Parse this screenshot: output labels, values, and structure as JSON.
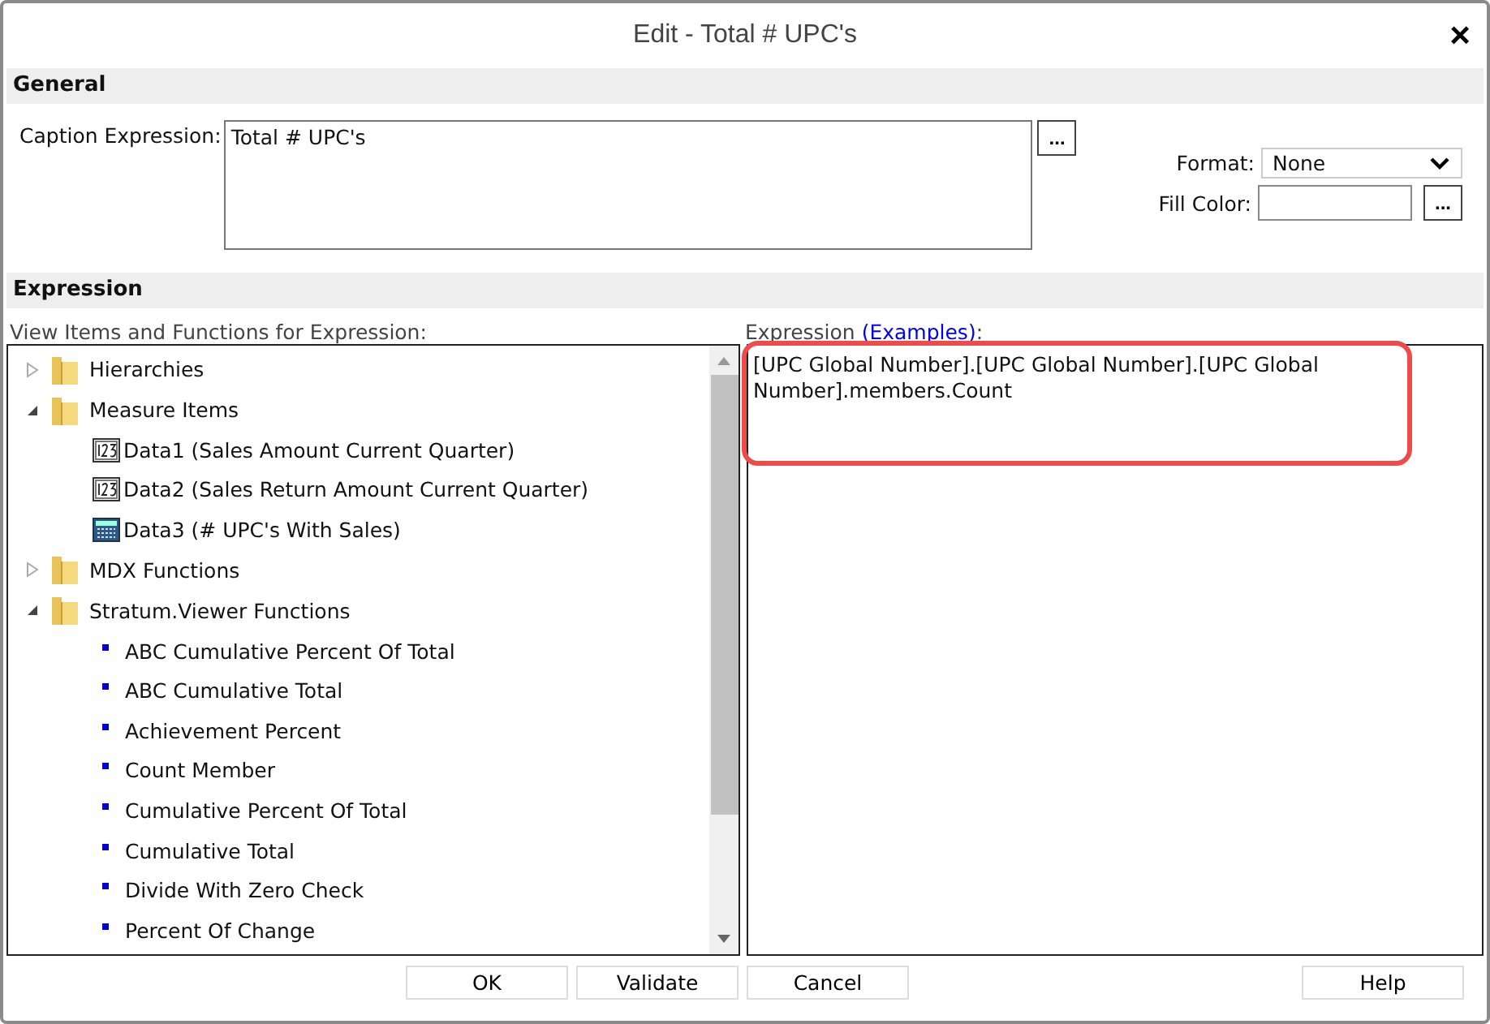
{
  "window": {
    "title": "Edit - Total # UPC's",
    "close": "×"
  },
  "general": {
    "heading": "General",
    "caption_label": "Caption Expression:",
    "caption_value": "Total # UPC's",
    "caption_button": "...",
    "format_label": "Format:",
    "format_value": "None",
    "fill_label": "Fill Color:",
    "fill_button": "..."
  },
  "expression": {
    "heading": "Expression",
    "tree_label": "View Items and Functions for Expression:",
    "editor_label": "Expression",
    "examples_link": "(Examples)",
    "editor_colon": ":",
    "editor_value": "[UPC Global Number].[UPC Global Number].[UPC Global Number].members.Count"
  },
  "tree": [
    {
      "kind": "folder",
      "label": "Hierarchies",
      "expanded": false
    },
    {
      "kind": "folder",
      "label": "Measure Items",
      "expanded": true,
      "children": [
        {
          "kind": "numeric",
          "label": "Data1 (Sales Amount Current Quarter)"
        },
        {
          "kind": "numeric",
          "label": "Data2 (Sales Return Amount Current Quarter)"
        },
        {
          "kind": "calculated",
          "label": "Data3 (# UPC's With Sales)"
        }
      ]
    },
    {
      "kind": "folder",
      "label": "MDX Functions",
      "expanded": false
    },
    {
      "kind": "folder",
      "label": "Stratum.Viewer Functions",
      "expanded": true,
      "children": [
        {
          "kind": "function",
          "label": "ABC Cumulative Percent Of Total"
        },
        {
          "kind": "function",
          "label": "ABC Cumulative Total"
        },
        {
          "kind": "function",
          "label": "Achievement Percent"
        },
        {
          "kind": "function",
          "label": "Count Member"
        },
        {
          "kind": "function",
          "label": "Cumulative Percent Of Total"
        },
        {
          "kind": "function",
          "label": "Cumulative Total"
        },
        {
          "kind": "function",
          "label": "Divide With Zero Check"
        },
        {
          "kind": "function",
          "label": "Percent Of Change"
        }
      ]
    }
  ],
  "buttons": [
    "OK",
    "Validate",
    "Cancel"
  ],
  "help_button": "Help"
}
